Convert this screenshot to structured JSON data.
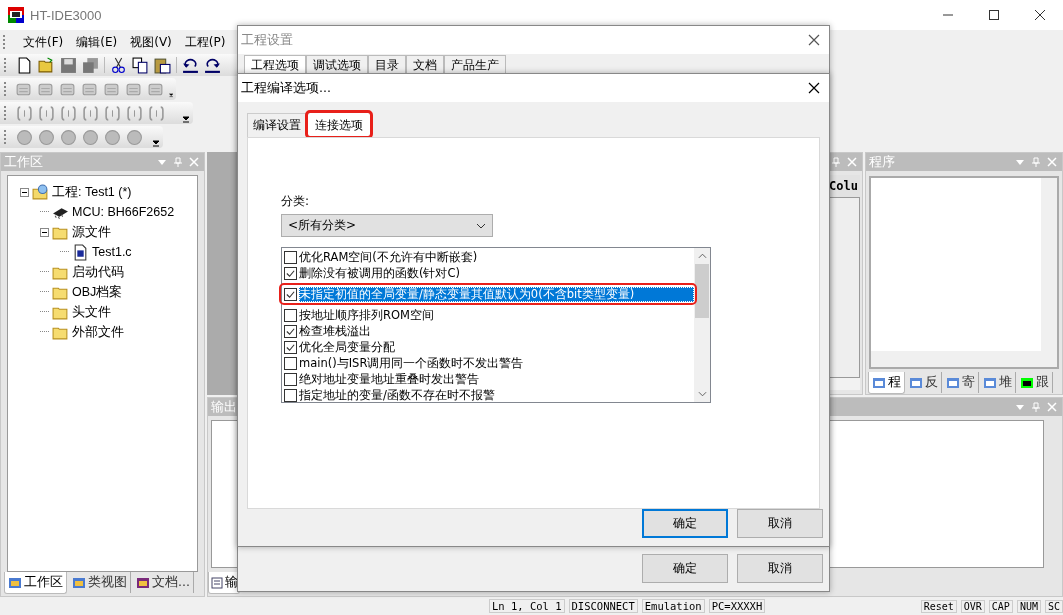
{
  "app": {
    "title": "HT-IDE3000"
  },
  "menu": [
    "文件(F)",
    "编辑(E)",
    "视图(V)",
    "工程(P)"
  ],
  "workspace": {
    "title": "工作区",
    "tree": [
      {
        "label": "工程: Test1 (*)",
        "kind": "project",
        "expanded": true,
        "children": [
          {
            "label": "MCU: BH66F2652",
            "kind": "chip"
          },
          {
            "label": "源文件",
            "kind": "folder",
            "expanded": true,
            "children": [
              {
                "label": "Test1.c",
                "kind": "file"
              }
            ]
          },
          {
            "label": "启动代码",
            "kind": "folder"
          },
          {
            "label": "OBJ档案",
            "kind": "folder"
          },
          {
            "label": "头文件",
            "kind": "folder"
          },
          {
            "label": "外部文件",
            "kind": "folder"
          }
        ]
      }
    ],
    "tabs": [
      {
        "label": "工作区",
        "selected": true
      },
      {
        "label": "类视图",
        "selected": false
      },
      {
        "label": "文档...",
        "selected": false
      }
    ]
  },
  "watch_panel": {
    "column_1": "Colu"
  },
  "program_panel": {
    "title": "程序",
    "tabs": [
      {
        "label": "程",
        "selected": true
      },
      {
        "label": "反",
        "selected": false
      },
      {
        "label": "寄",
        "selected": false
      },
      {
        "label": "堆",
        "selected": false
      },
      {
        "label": "跟",
        "selected": false
      }
    ]
  },
  "output_panel": {
    "title": "输出",
    "tab": "输"
  },
  "status_bar": {
    "position": "Ln 1, Col 1",
    "connection": "DISCONNECT",
    "mode": "Emulation",
    "pc": "PC=XXXXH",
    "indicators": [
      "Reset",
      "OVR",
      "CAP",
      "NUM",
      "SC"
    ]
  },
  "project_settings": {
    "title": "工程设置",
    "tabs": [
      {
        "label": "工程选项",
        "selected": true
      },
      {
        "label": "调试选项",
        "selected": false
      },
      {
        "label": "目录",
        "selected": false
      },
      {
        "label": "文档",
        "selected": false
      },
      {
        "label": "产品生产",
        "selected": false
      }
    ],
    "buttons": [
      "确定",
      "取消"
    ]
  },
  "compile_options": {
    "title": "工程编译选项...",
    "tabs": [
      {
        "label": "编译设置",
        "selected": false,
        "highlighted": false
      },
      {
        "label": "连接选项",
        "selected": true,
        "highlighted": true
      }
    ],
    "category_label": "分类:",
    "category": "<所有分类>",
    "options": [
      {
        "label": "优化RAM空间(不允许有中断嵌套)",
        "checked": false,
        "selected": false,
        "highlighted": false
      },
      {
        "label": "删除没有被调用的函数(针对C)",
        "checked": true,
        "selected": false,
        "highlighted": false
      },
      {
        "label": "未指定初值的全局变量/静态变量其值默认为0(不含bit类型变量)",
        "checked": true,
        "selected": true,
        "highlighted": true
      },
      {
        "label": "按地址顺序排列ROM空间",
        "checked": false,
        "selected": false,
        "highlighted": false
      },
      {
        "label": "检查堆栈溢出",
        "checked": true,
        "selected": false,
        "highlighted": false
      },
      {
        "label": "优化全局变量分配",
        "checked": true,
        "selected": false,
        "highlighted": false
      },
      {
        "label": "main()与ISR调用同一个函数时不发出警告",
        "checked": false,
        "selected": false,
        "highlighted": false
      },
      {
        "label": "绝对地址变量地址重叠时发出警告",
        "checked": false,
        "selected": false,
        "highlighted": false
      },
      {
        "label": "指定地址的变量/函数不存在时不报警",
        "checked": false,
        "selected": false,
        "highlighted": false
      }
    ],
    "buttons": [
      {
        "label": "确定",
        "default": true
      },
      {
        "label": "取消",
        "default": false
      }
    ]
  }
}
